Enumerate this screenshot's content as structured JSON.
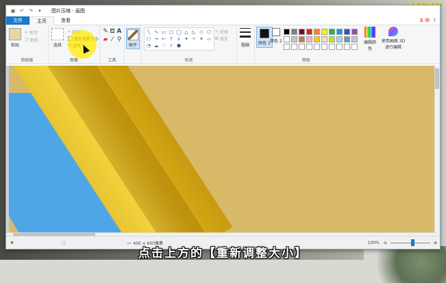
{
  "watermark": "MOW",
  "window": {
    "title": "图片压缩 - 画图",
    "quick_access": [
      "save-icon",
      "undo-icon",
      "redo-icon",
      "dropdown-icon"
    ]
  },
  "tabs": [
    {
      "label": "文件"
    },
    {
      "label": "主页"
    },
    {
      "label": "查看"
    }
  ],
  "ribbon_extras": {
    "ime": "S 中",
    "help": "?"
  },
  "clipboard": {
    "paste_label": "粘贴",
    "cut_label": "剪切",
    "copy_label": "复制",
    "group_label": "剪贴板"
  },
  "image_group": {
    "select_label": "选择",
    "crop_label": "裁剪",
    "resize_label": "重新调整大小",
    "rotate_label": "旋转",
    "group_label": "图像"
  },
  "tools_group": {
    "group_label": "工具",
    "tools": [
      "pencil-icon",
      "fill-icon",
      "text-icon",
      "eraser-icon",
      "color-picker-icon",
      "magnifier-icon"
    ]
  },
  "brush": {
    "label": "刷子"
  },
  "shapes_group": {
    "outline_label": "轮廓",
    "fill_label": "填充",
    "group_label": "形状",
    "shapes": [
      "╲",
      "∿",
      "▭",
      "▢",
      "◯",
      "△",
      "◺",
      "◇",
      "⬠",
      "⬡",
      "→",
      "←",
      "↑",
      "↓",
      "✦",
      "✧",
      "✶",
      "▱",
      "◔",
      "☁",
      "♡",
      "⚡",
      "⬟"
    ]
  },
  "size": {
    "label": "粗细"
  },
  "colors_group": {
    "color1_label": "颜色 1",
    "color2_label": "颜色 2",
    "edit_label": "编辑颜色",
    "paint3d_label": "使用画图 3D 进行编辑",
    "group_label": "颜色",
    "color1": "#111111",
    "color2": "#ffffff",
    "palette": [
      "#000000",
      "#7f7f7f",
      "#880015",
      "#ed1c24",
      "#ff7f27",
      "#fff200",
      "#22b14c",
      "#00a2e8",
      "#3f48cc",
      "#a349a4",
      "#ffffff",
      "#c3c3c3",
      "#b97a57",
      "#ffaec9",
      "#ffc90e",
      "#efe4b0",
      "#b5e61d",
      "#99d9ea",
      "#7092be",
      "#c8bfe7",
      "#ffffff",
      "#ffffff",
      "#ffffff",
      "#ffffff",
      "#ffffff",
      "#ffffff",
      "#ffffff",
      "#ffffff",
      "#ffffff",
      "#ffffff"
    ]
  },
  "status": {
    "dimensions": "400 × 600像素",
    "zoom": "100%",
    "zoom_level": 0.55
  },
  "subtitle": "点击上方的【重新调整大小】"
}
